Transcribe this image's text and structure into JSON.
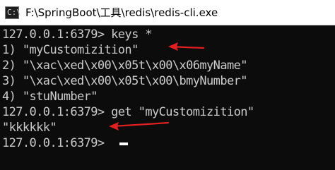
{
  "window": {
    "title": "F:\\SpringBoot\\工具\\redis\\redis-cli.exe",
    "icon": "console-icon",
    "icon_glyph": "C:\\"
  },
  "console": {
    "lines": [
      "127.0.0.1:6379> keys *",
      "1) \"myCustomizition\"",
      "2) \"\\xac\\xed\\x00\\x05t\\x00\\x06myName\"",
      "3) \"\\xac\\xed\\x00\\x05t\\x00\\bmyNumber\"",
      "4) \"stuNumber\"",
      "127.0.0.1:6379> get \"myCustomizition\"",
      "\"kkkkkk\"",
      "127.0.0.1:6379> "
    ]
  },
  "colors": {
    "console_bg": "#0c0c0c",
    "console_text": "#cccccc",
    "annotation_arrow": "#e02020"
  }
}
